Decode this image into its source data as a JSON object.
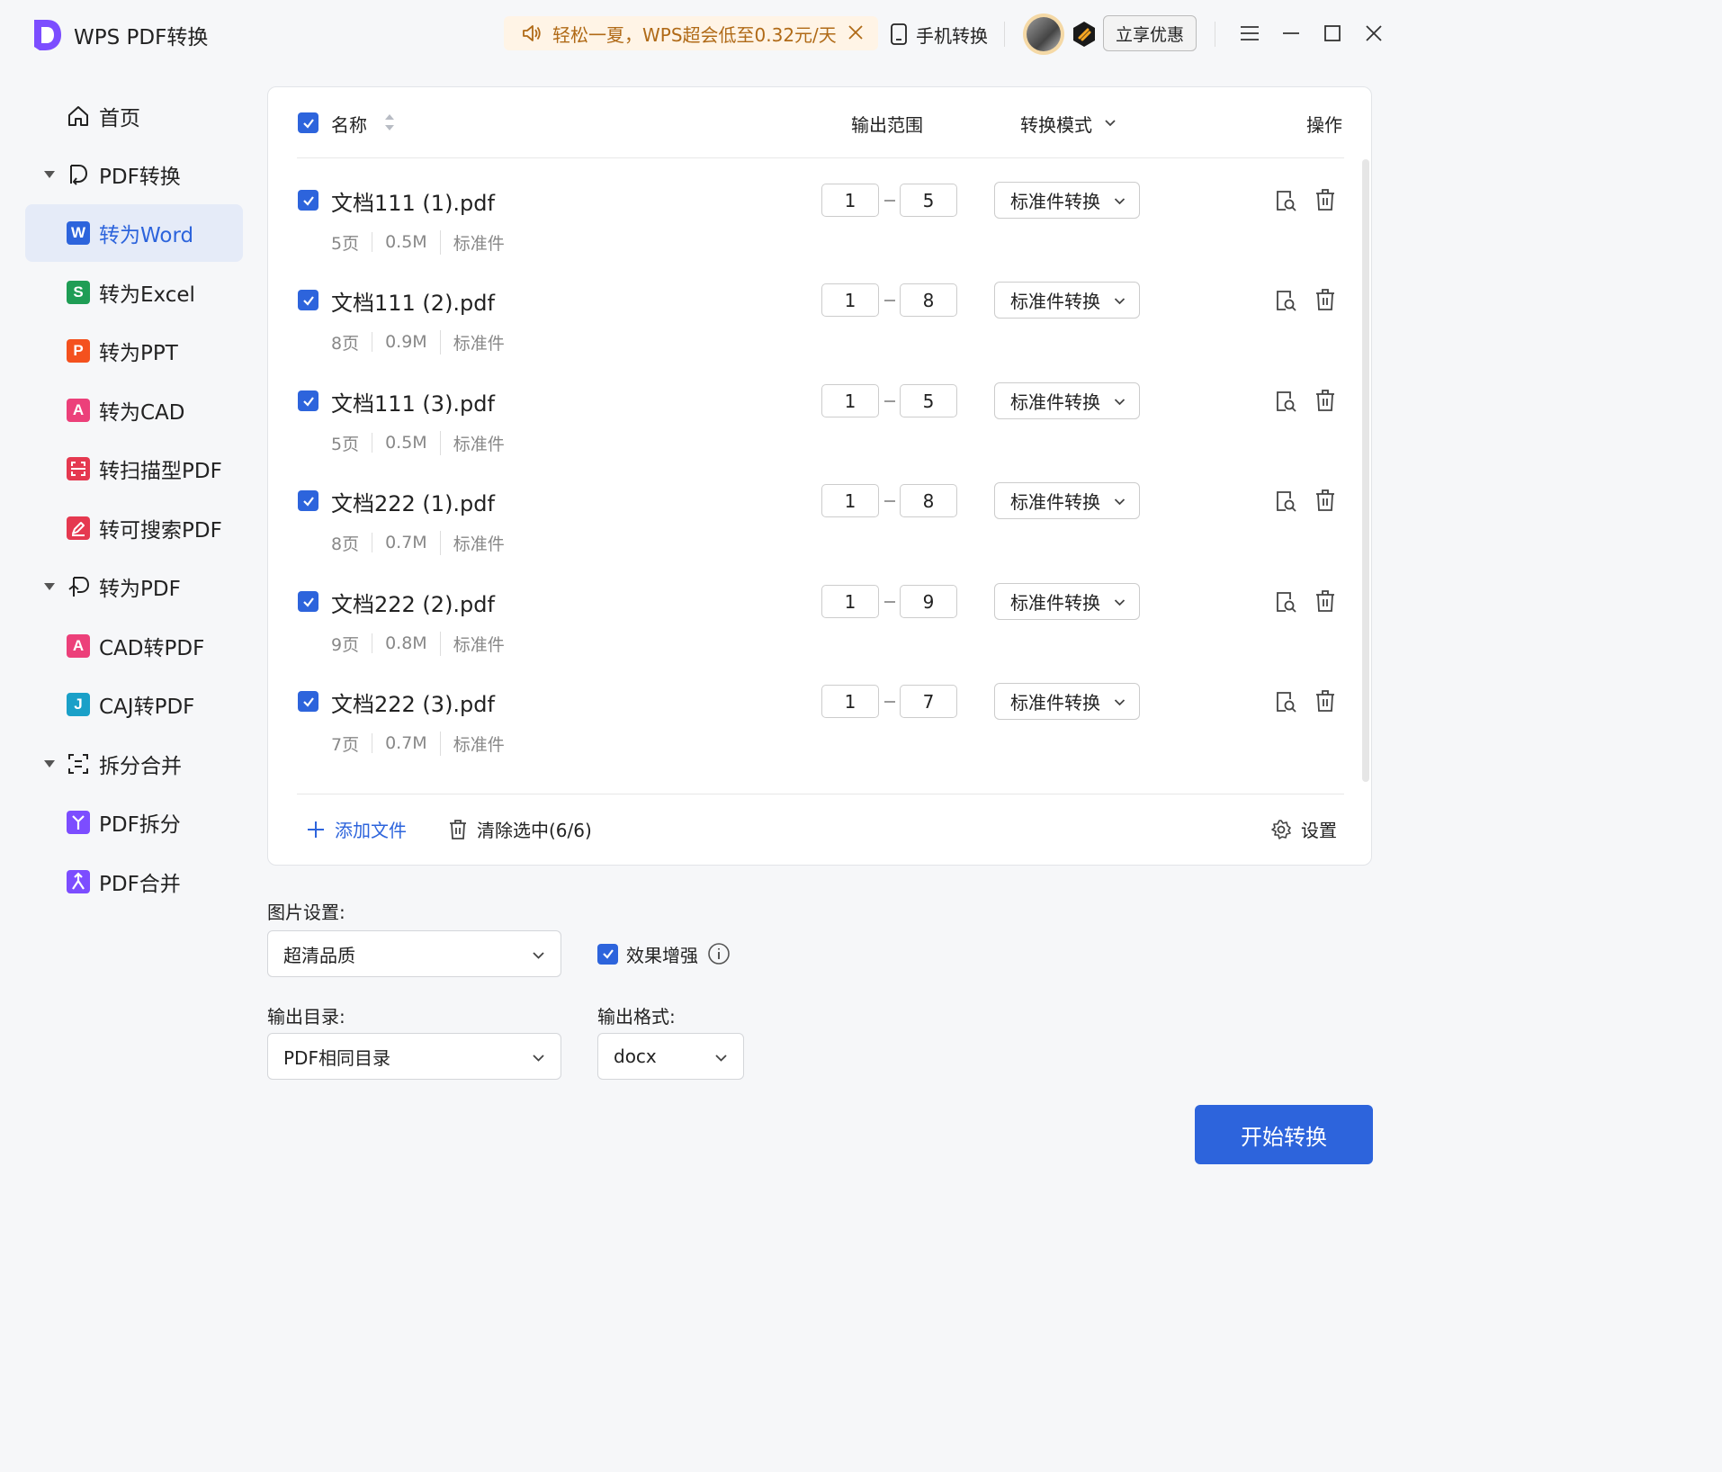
{
  "app": {
    "title": "WPS PDF转换",
    "brand_color": "#7c4dff"
  },
  "titlebar": {
    "promo_text": "轻松一夏，WPS超会低至0.32元/天",
    "mobile_convert": "手机转换",
    "promo_button": "立享优惠"
  },
  "sidebar": {
    "items": [
      {
        "label": "首页",
        "icon": "home-icon"
      },
      {
        "label": "PDF转换",
        "icon": "pdf-convert-icon",
        "expanded": true
      },
      {
        "label": "转为Word",
        "icon": "word-icon",
        "badge": "W",
        "color": "#2d64dc",
        "active": true
      },
      {
        "label": "转为Excel",
        "icon": "excel-icon",
        "badge": "S",
        "color": "#1f9d55"
      },
      {
        "label": "转为PPT",
        "icon": "ppt-icon",
        "badge": "P",
        "color": "#f4511e"
      },
      {
        "label": "转为CAD",
        "icon": "cad-icon",
        "badge": "A",
        "color": "#ec407a"
      },
      {
        "label": "转扫描型PDF",
        "icon": "scan-pdf-icon",
        "color": "#e53950"
      },
      {
        "label": "转可搜索PDF",
        "icon": "searchable-pdf-icon",
        "color": "#e53950"
      },
      {
        "label": "转为PDF",
        "icon": "to-pdf-icon",
        "expanded": true
      },
      {
        "label": "CAD转PDF",
        "icon": "cad-to-pdf-icon",
        "badge": "A",
        "color": "#ec407a"
      },
      {
        "label": "CAJ转PDF",
        "icon": "caj-to-pdf-icon",
        "badge": "J",
        "color": "#1aa0c8"
      },
      {
        "label": "拆分合并",
        "icon": "split-merge-icon",
        "expanded": true
      },
      {
        "label": "PDF拆分",
        "icon": "pdf-split-icon",
        "color": "#7c4dff"
      },
      {
        "label": "PDF合并",
        "icon": "pdf-merge-icon",
        "color": "#7c4dff"
      }
    ]
  },
  "table": {
    "headers": {
      "name": "名称",
      "range": "输出范围",
      "mode": "转换模式",
      "ops": "操作"
    },
    "rows": [
      {
        "name": "文档111 (1).pdf",
        "pages": "5页",
        "size": "0.5M",
        "kind": "标准件",
        "from": "1",
        "to": "5",
        "mode": "标准件转换"
      },
      {
        "name": "文档111 (2).pdf",
        "pages": "8页",
        "size": "0.9M",
        "kind": "标准件",
        "from": "1",
        "to": "8",
        "mode": "标准件转换"
      },
      {
        "name": "文档111 (3).pdf",
        "pages": "5页",
        "size": "0.5M",
        "kind": "标准件",
        "from": "1",
        "to": "5",
        "mode": "标准件转换"
      },
      {
        "name": "文档222 (1).pdf",
        "pages": "8页",
        "size": "0.7M",
        "kind": "标准件",
        "from": "1",
        "to": "8",
        "mode": "标准件转换"
      },
      {
        "name": "文档222 (2).pdf",
        "pages": "9页",
        "size": "0.8M",
        "kind": "标准件",
        "from": "1",
        "to": "9",
        "mode": "标准件转换"
      },
      {
        "name": "文档222 (3).pdf",
        "pages": "7页",
        "size": "0.7M",
        "kind": "标准件",
        "from": "1",
        "to": "7",
        "mode": "标准件转换"
      }
    ],
    "add_file": "添加文件",
    "clear_selected": "清除选中(6/6)",
    "settings": "设置"
  },
  "options": {
    "image_label": "图片设置:",
    "image_quality": "超清品质",
    "enhance_label": "效果增强",
    "output_dir_label": "输出目录:",
    "output_dir": "PDF相同目录",
    "output_format_label": "输出格式:",
    "output_format": "docx"
  },
  "start_button": "开始转换",
  "colors": {
    "accent": "#2d64dc",
    "active_bg": "#e5ebf8",
    "promo_text": "#b06a17"
  }
}
